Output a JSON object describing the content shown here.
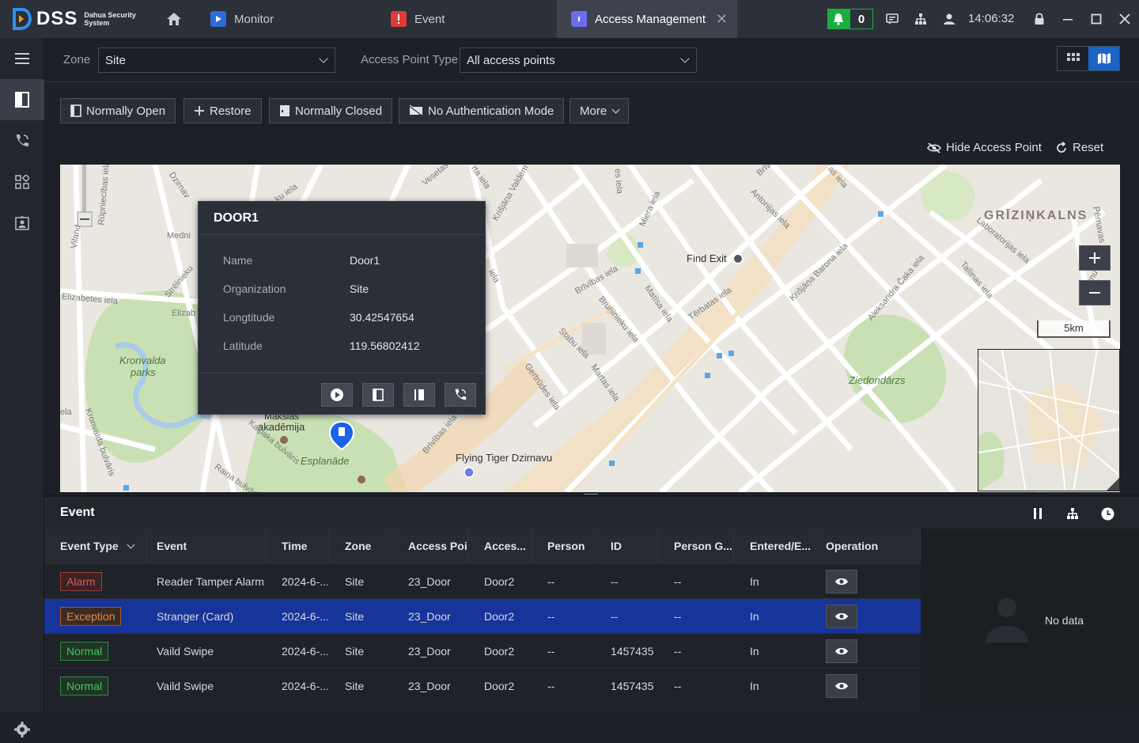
{
  "app": {
    "brand": "DSS",
    "brand_sub_1": "Dahua Security",
    "brand_sub_2": "System"
  },
  "tabs": [
    {
      "label": "Monitor",
      "icon": "monitor-icon",
      "color": "#2d6bd9"
    },
    {
      "label": "Event",
      "icon": "event-alarm-icon",
      "color": "#e03a3a"
    },
    {
      "label": "Access Management",
      "icon": "access-management-icon",
      "color": "#6c6cf0",
      "active": true
    }
  ],
  "titlebar": {
    "alarm_count": "0",
    "time": "14:06:32"
  },
  "filters": {
    "zone_label": "Zone",
    "zone_value": "Site",
    "access_point_type_label": "Access Point Type",
    "access_point_type_value": "All access points"
  },
  "toolbar": {
    "normally_open": "Normally Open",
    "restore": "Restore",
    "normally_closed": "Normally Closed",
    "no_auth_mode": "No Authentication Mode",
    "more": "More",
    "hide_access_point": "Hide Access Point",
    "reset": "Reset"
  },
  "map": {
    "scale": "5km",
    "labels": {
      "grizinkalns": "GRĪZIŅKALNS",
      "find_exit": "Find Exit",
      "kronvalda": "Kronvalda",
      "parks": "parks",
      "ziedondarzs": "Ziedondārzs",
      "esplanade": "Esplanāde",
      "flying_tiger": "Flying Tiger Dzirnavu",
      "akademija": "akadēmija",
      "maksias": "Makslas",
      "brivibas": "Brīvības iela",
      "terbatas": "Tērbatas iela",
      "matisa": "Matīsa iela",
      "krisjana": "Krišjāņa Barona iela",
      "aleksandra": "Aleksandra Čaka iela",
      "gertrudes": "Gertrūdes iela",
      "elizabetes": "Elizabetes iela",
      "strelnieku": "Strēlnieku",
      "raina": "Raiņa bulvāris",
      "kalpaka": "Kalpaka bulvāris",
      "kronvalda_bulvaris": "Kronvalda bulvāris",
      "rupniecibas": "Rūpniecības iela",
      "brunieku": "Bruņinieku iela",
      "stabu": "Stabu iela",
      "tallinas": "Tallinas iela",
      "laboratorijas": "Laboratorijas iela",
      "miera": "Miera iela",
      "antonijas": "Antonijas iela",
      "vesetas": "Vesetas",
      "martas": "Martas iela",
      "medn": "Medni",
      "dzirnav": "Dzirnav",
      "viland": "Viland",
      "elizab": "Elizab",
      "ela": "ela",
      "ku_iela": "ku iela",
      "valdem": "Krišjāņa Valdem",
      "brin": "Brīv",
      "pernavas": "Pērnavas",
      "ta_iela": "rta iela",
      "as_iela": "as iela",
      "es_iela": "es iela",
      "ela2": "iela",
      "virnu": "Vīrnu",
      "brivibas2": "Brīvības iela"
    }
  },
  "popup": {
    "title": "DOOR1",
    "rows": [
      {
        "label": "Name",
        "value": "Door1"
      },
      {
        "label": "Organization",
        "value": "Site"
      },
      {
        "label": "Longtitude",
        "value": "30.42547654"
      },
      {
        "label": "Latitude",
        "value": "119.56802412"
      }
    ]
  },
  "event_panel": {
    "title": "Event",
    "columns": [
      "Event Type",
      "Event",
      "Time",
      "Zone",
      "Access Point",
      "Acces...",
      "Person",
      "ID",
      "Person G...",
      "Entered/E...",
      "Operation"
    ],
    "rows": [
      {
        "type": "Alarm",
        "type_class": "alarm",
        "event": "Reader Tamper Alarm",
        "time": "2024-6-...",
        "zone": "Site",
        "access_point": "23_Door",
        "access": "Door2",
        "person": "--",
        "id": "--",
        "person_group": "--",
        "entered": "In"
      },
      {
        "type": "Exception",
        "type_class": "exception",
        "event": "Stranger (Card)",
        "time": "2024-6-...",
        "zone": "Site",
        "access_point": "23_Door",
        "access": "Door2",
        "person": "--",
        "id": "--",
        "person_group": "--",
        "entered": "In",
        "selected": true
      },
      {
        "type": "Normal",
        "type_class": "normal",
        "event": "Vaild Swipe",
        "time": "2024-6-...",
        "zone": "Site",
        "access_point": "23_Door",
        "access": "Door2",
        "person": "--",
        "id": "1457435",
        "person_group": "--",
        "entered": "In"
      },
      {
        "type": "Normal",
        "type_class": "normal",
        "event": "Vaild Swipe",
        "time": "2024-6-...",
        "zone": "Site",
        "access_point": "23_Door",
        "access": "Door2",
        "person": "--",
        "id": "1457435",
        "person_group": "--",
        "entered": "In"
      }
    ],
    "no_data": "No data"
  }
}
